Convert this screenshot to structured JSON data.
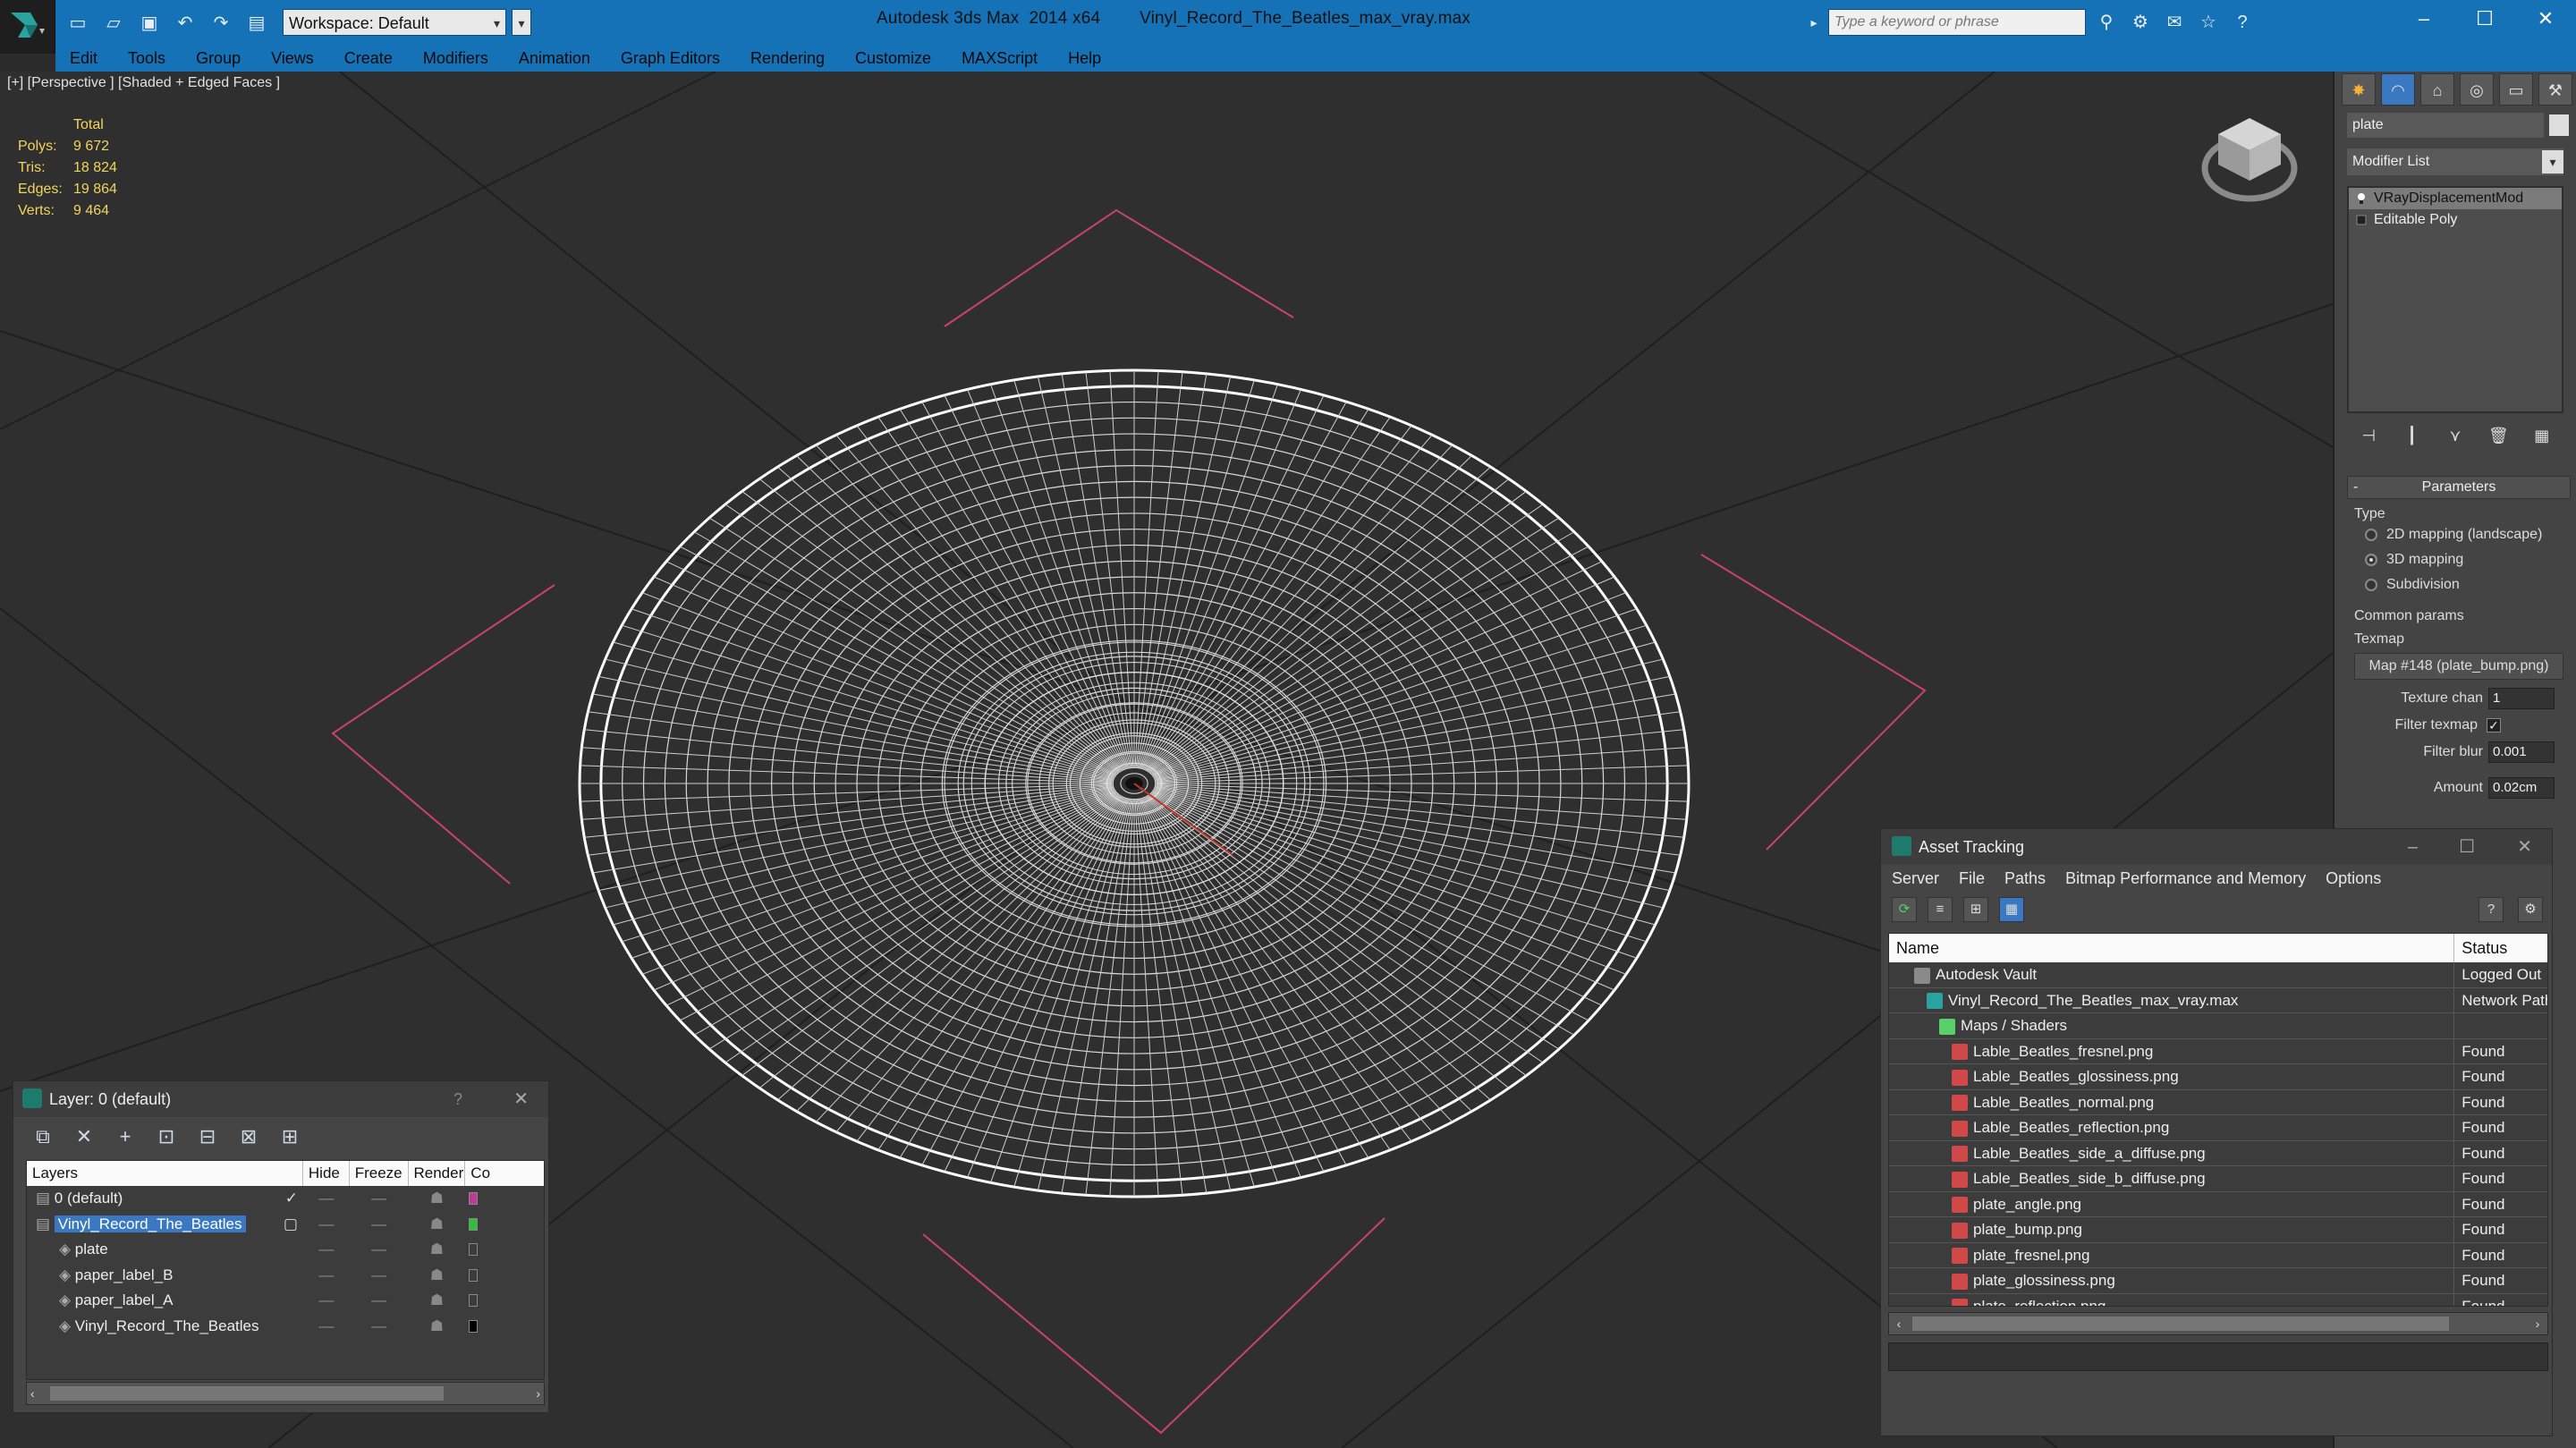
{
  "window": {
    "app_title": "Autodesk 3ds Max  2014 x64",
    "file_title": "Vinyl_Record_The_Beatles_max_vray.max",
    "workspace_label": "Workspace: Default",
    "search_placeholder": "Type a keyword or phrase"
  },
  "menu": [
    "Edit",
    "Tools",
    "Group",
    "Views",
    "Create",
    "Modifiers",
    "Animation",
    "Graph Editors",
    "Rendering",
    "Customize",
    "MAXScript",
    "Help"
  ],
  "viewport": {
    "label": "[+] [Perspective ] [Shaded + Edged Faces ]",
    "stats_header": "Total",
    "stats": [
      {
        "key": "Polys:",
        "value": "9 672"
      },
      {
        "key": "Tris:",
        "value": "18 824"
      },
      {
        "key": "Edges:",
        "value": "19 864"
      },
      {
        "key": "Verts:",
        "value": "9 464"
      }
    ]
  },
  "command_panel": {
    "object_name": "plate",
    "modifier_list": "Modifier List",
    "stack": [
      "VRayDisplacementMod",
      "Editable Poly"
    ],
    "params_title": "Parameters",
    "type_label": "Type",
    "type_options": [
      "2D mapping (landscape)",
      "3D mapping",
      "Subdivision"
    ],
    "type_selected": 1,
    "common_params": "Common params",
    "texmap_label": "Texmap",
    "texmap_value": "Map #148 (plate_bump.png)",
    "texture_chan_label": "Texture chan",
    "texture_chan_value": "1",
    "filter_texmap_label": "Filter texmap",
    "filter_blur_label": "Filter blur",
    "filter_blur_value": "0.001",
    "amount_label": "Amount",
    "amount_value": "0.02cm"
  },
  "asset_tracking": {
    "title": "Asset Tracking",
    "menu": [
      "Server",
      "File",
      "Paths",
      "Bitmap Performance and Memory",
      "Options"
    ],
    "col_name": "Name",
    "col_status": "Status",
    "rows": [
      {
        "name": "Autodesk Vault",
        "status": "Logged Out",
        "level": 0,
        "icon": "vault-icon"
      },
      {
        "name": "Vinyl_Record_The_Beatles_max_vray.max",
        "status": "Network Path",
        "level": 1,
        "icon": "max-file-icon"
      },
      {
        "name": "Maps / Shaders",
        "status": "",
        "level": 2,
        "icon": "maps-icon"
      },
      {
        "name": "Lable_Beatles_fresnel.png",
        "status": "Found",
        "level": 3,
        "icon": "png-icon"
      },
      {
        "name": "Lable_Beatles_glossiness.png",
        "status": "Found",
        "level": 3,
        "icon": "png-icon"
      },
      {
        "name": "Lable_Beatles_normal.png",
        "status": "Found",
        "level": 3,
        "icon": "png-icon"
      },
      {
        "name": "Lable_Beatles_reflection.png",
        "status": "Found",
        "level": 3,
        "icon": "png-icon"
      },
      {
        "name": "Lable_Beatles_side_a_diffuse.png",
        "status": "Found",
        "level": 3,
        "icon": "png-icon"
      },
      {
        "name": "Lable_Beatles_side_b_diffuse.png",
        "status": "Found",
        "level": 3,
        "icon": "png-icon"
      },
      {
        "name": "plate_angle.png",
        "status": "Found",
        "level": 3,
        "icon": "png-icon"
      },
      {
        "name": "plate_bump.png",
        "status": "Found",
        "level": 3,
        "icon": "png-icon"
      },
      {
        "name": "plate_fresnel.png",
        "status": "Found",
        "level": 3,
        "icon": "png-icon"
      },
      {
        "name": "plate_glossiness.png",
        "status": "Found",
        "level": 3,
        "icon": "png-icon"
      },
      {
        "name": "plate_reflection.png",
        "status": "Found",
        "level": 3,
        "icon": "png-icon"
      }
    ]
  },
  "layer_dialog": {
    "title": "Layer: 0 (default)",
    "help": "?",
    "columns": [
      "Layers",
      "Hide",
      "Freeze",
      "Render",
      "Co"
    ],
    "rows": [
      {
        "name": "0 (default)",
        "level": 0,
        "selected": false,
        "active": true,
        "color": "#c0389a"
      },
      {
        "name": "Vinyl_Record_The_Beatles",
        "level": 0,
        "selected": true,
        "active": false,
        "color": "#2fbf3a"
      },
      {
        "name": "plate",
        "level": 1,
        "selected": false,
        "active": false,
        "color": ""
      },
      {
        "name": "paper_label_B",
        "level": 1,
        "selected": false,
        "active": false,
        "color": ""
      },
      {
        "name": "paper_label_A",
        "level": 1,
        "selected": false,
        "active": false,
        "color": ""
      },
      {
        "name": "Vinyl_Record_The_Beatles",
        "level": 1,
        "selected": false,
        "active": false,
        "color": "#000000"
      }
    ]
  },
  "colors": {
    "title_bar": "#1572b6",
    "viewport_bg": "#2f2f2f",
    "stats_text": "#f2d45a",
    "bracket_lines": "#c8436e",
    "selection": "#3a78c2"
  }
}
